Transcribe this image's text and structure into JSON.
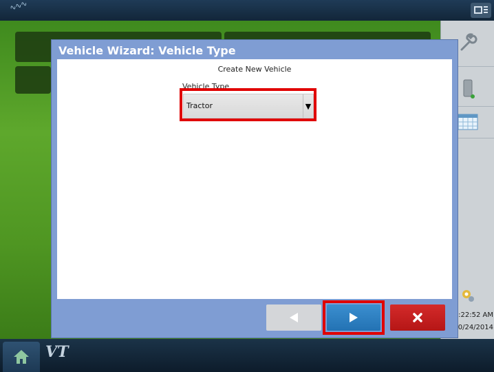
{
  "status_bar": {
    "gps_icon": "gps-signal-icon",
    "top_right_icon": "display-layout-icon"
  },
  "dialog": {
    "title": "Vehicle Wizard: Vehicle Type",
    "subtitle": "Create New Vehicle",
    "vehicle_type_label": "Vehicle Type",
    "vehicle_type_value": "Tractor",
    "buttons": {
      "back_icon": "left-arrow-icon",
      "next_icon": "right-arrow-icon",
      "cancel_icon": "close-icon"
    }
  },
  "sidebar": {
    "icons": [
      "wrench-icon",
      "data-card-icon",
      "calendar-grid-icon",
      "settings-gear-icon"
    ],
    "time": ":22:52 AM",
    "date": "0/24/2014"
  },
  "bottom_bar": {
    "home_icon": "home-icon",
    "vt_label": "VT"
  },
  "colors": {
    "dialog_title_bg": "#7f9dd3",
    "next_button": "#2372b3",
    "cancel_button": "#c41f1f",
    "highlight": "#e00000"
  }
}
